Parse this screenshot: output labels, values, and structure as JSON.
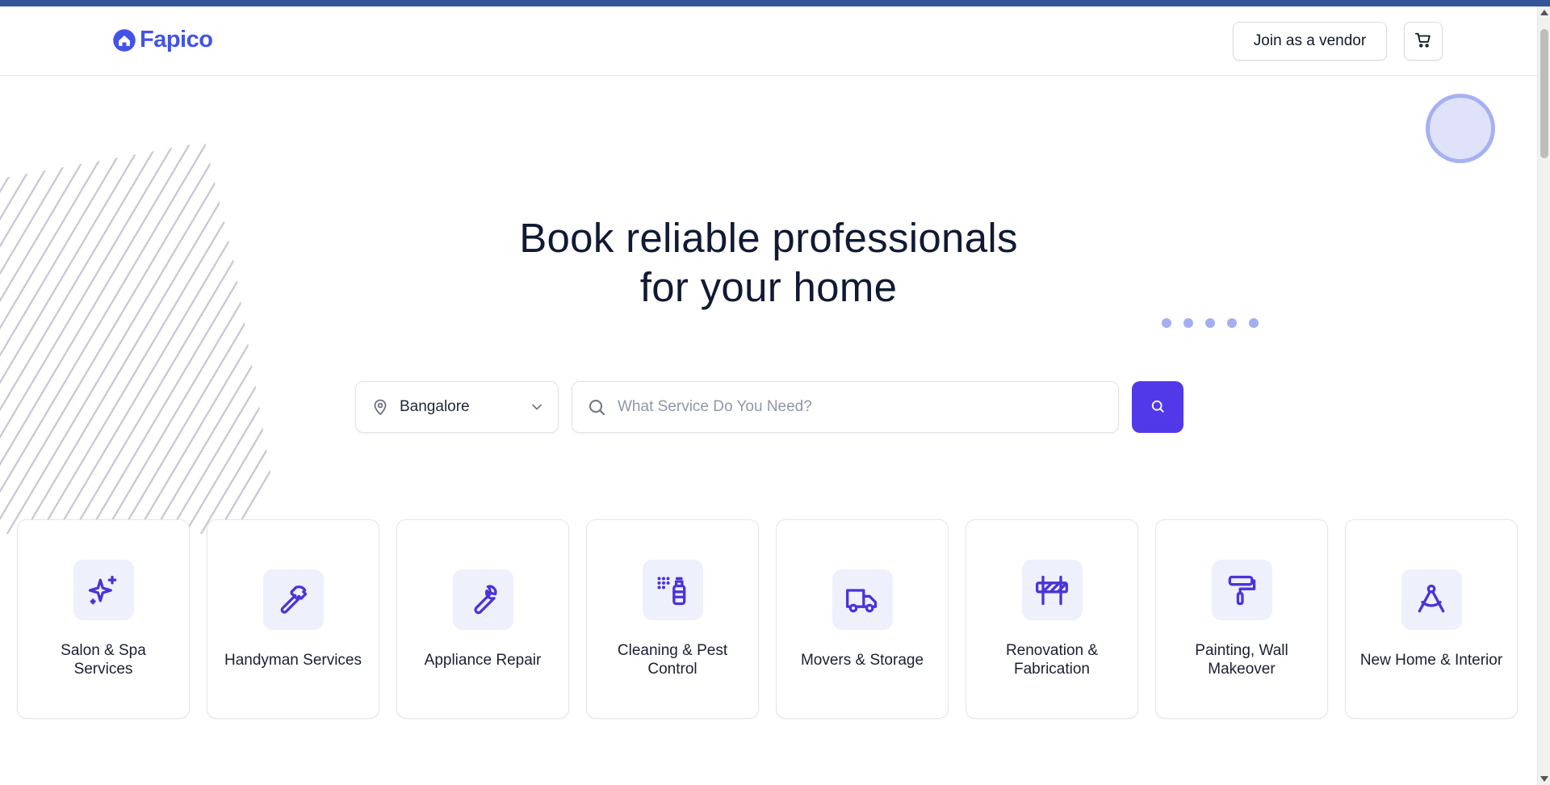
{
  "brand": {
    "name": "Fapico",
    "accent": "#4353e6",
    "primary_button": "#5139ea"
  },
  "header": {
    "vendor_button": "Join as a vendor",
    "cart_icon": "shopping-cart-icon"
  },
  "hero": {
    "title_line1": "Book reliable professionals",
    "title_line2": "for your home"
  },
  "search": {
    "city": "Bangalore",
    "placeholder": "What Service Do You Need?",
    "value": ""
  },
  "categories": [
    {
      "label": "Salon & Spa Services",
      "icon": "sparkles-icon"
    },
    {
      "label": "Handyman Services",
      "icon": "hammer-icon"
    },
    {
      "label": "Appliance Repair",
      "icon": "wrench-icon"
    },
    {
      "label": "Cleaning & Pest Control",
      "icon": "spray-bottle-icon"
    },
    {
      "label": "Movers & Storage",
      "icon": "truck-icon"
    },
    {
      "label": "Renovation & Fabrication",
      "icon": "barrier-icon"
    },
    {
      "label": "Painting, Wall Makeover",
      "icon": "paint-roller-icon"
    },
    {
      "label": "New Home & Interior",
      "icon": "compass-icon"
    }
  ]
}
